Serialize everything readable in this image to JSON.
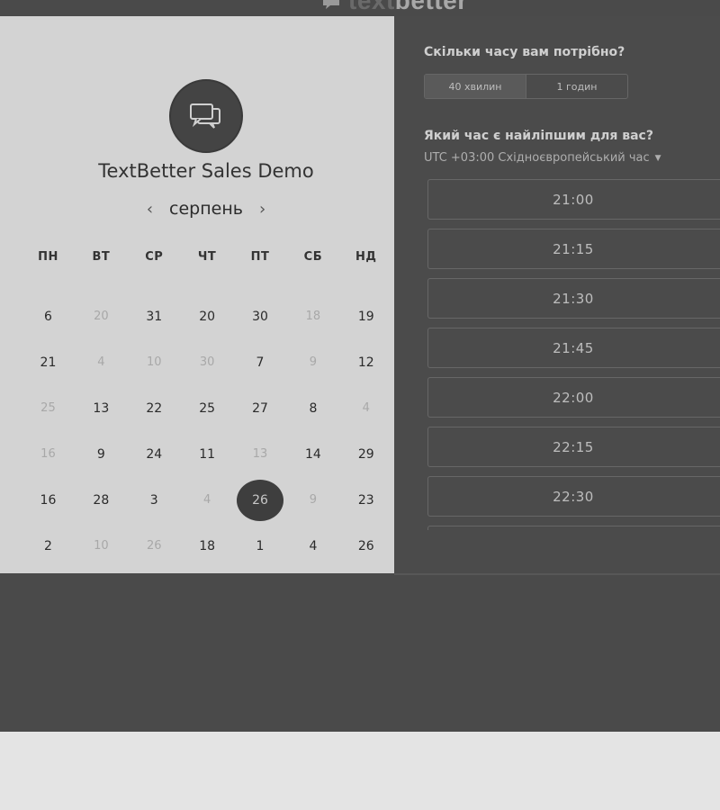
{
  "brand": {
    "faint_part": "text",
    "strong_part": "better"
  },
  "event": {
    "title": "TextBetter Sales Demo",
    "avatar_icon": "chat-bubbles-icon"
  },
  "calendar": {
    "month": "серпень",
    "prev_icon": "chevron-left-icon",
    "next_icon": "chevron-right-icon",
    "weekdays": [
      "ПН",
      "ВТ",
      "СР",
      "ЧТ",
      "ПТ",
      "СБ",
      "НД"
    ],
    "rows": [
      [
        {
          "d": "6",
          "m": false
        },
        {
          "d": "20",
          "m": true
        },
        {
          "d": "31",
          "m": false
        },
        {
          "d": "20",
          "m": false
        },
        {
          "d": "30",
          "m": false
        },
        {
          "d": "18",
          "m": true
        },
        {
          "d": "19",
          "m": false
        }
      ],
      [
        {
          "d": "21",
          "m": false
        },
        {
          "d": "4",
          "m": true
        },
        {
          "d": "10",
          "m": true
        },
        {
          "d": "30",
          "m": true
        },
        {
          "d": "7",
          "m": false
        },
        {
          "d": "9",
          "m": true
        },
        {
          "d": "12",
          "m": false
        }
      ],
      [
        {
          "d": "25",
          "m": true
        },
        {
          "d": "13",
          "m": false
        },
        {
          "d": "22",
          "m": false
        },
        {
          "d": "25",
          "m": false
        },
        {
          "d": "27",
          "m": false
        },
        {
          "d": "8",
          "m": false
        },
        {
          "d": "4",
          "m": true
        }
      ],
      [
        {
          "d": "16",
          "m": true
        },
        {
          "d": "9",
          "m": false
        },
        {
          "d": "24",
          "m": false
        },
        {
          "d": "11",
          "m": false
        },
        {
          "d": "13",
          "m": true
        },
        {
          "d": "14",
          "m": false
        },
        {
          "d": "29",
          "m": false
        }
      ],
      [
        {
          "d": "16",
          "m": false
        },
        {
          "d": "28",
          "m": false
        },
        {
          "d": "3",
          "m": false
        },
        {
          "d": "4",
          "m": true
        },
        {
          "d": "26",
          "m": false,
          "sel": true
        },
        {
          "d": "9",
          "m": true
        },
        {
          "d": "23",
          "m": false
        }
      ],
      [
        {
          "d": "2",
          "m": false
        },
        {
          "d": "10",
          "m": true
        },
        {
          "d": "26",
          "m": true
        },
        {
          "d": "18",
          "m": false
        },
        {
          "d": "1",
          "m": false
        },
        {
          "d": "4",
          "m": false
        },
        {
          "d": "26",
          "m": false
        }
      ]
    ]
  },
  "duration": {
    "question": "Скільки часу вам потрібно?",
    "options": [
      "40 хвилин",
      "1 годин"
    ],
    "selected_index": 0
  },
  "time": {
    "question": "Який час є найліпшим для вас?",
    "timezone": "UTC +03:00 Східноєвропейський час",
    "slots": [
      "21:00",
      "21:15",
      "21:30",
      "21:45",
      "22:00",
      "22:15",
      "22:30",
      ""
    ]
  }
}
